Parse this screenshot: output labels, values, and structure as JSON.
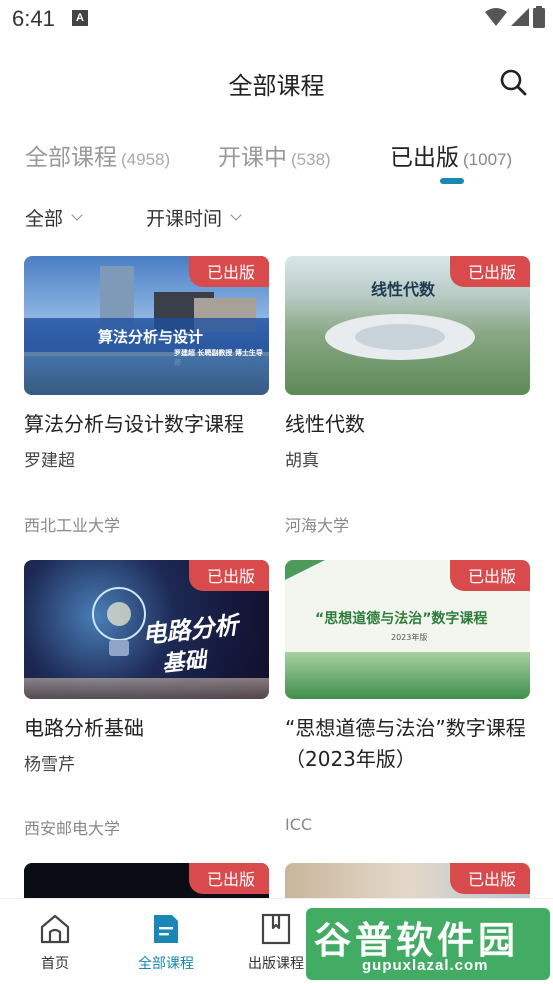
{
  "status_bar": {
    "time": "6:41",
    "notif_letter": "A"
  },
  "header": {
    "title": "全部课程"
  },
  "tabs": [
    {
      "label": "全部课程",
      "count": "(4958)"
    },
    {
      "label": "开课中",
      "count": "(538)"
    },
    {
      "label": "已出版",
      "count": "(1007)"
    }
  ],
  "active_tab": "已出版",
  "filters": {
    "category": "全部",
    "sort": "开课时间"
  },
  "badge_label": "已出版",
  "courses": [
    {
      "title": "算法分析与设计数字课程",
      "teacher": "罗建超",
      "school": "西北工业大学",
      "cover_text": "算法分析与设计",
      "cover_subtext": "罗建超 长聘副教授 博士生导师"
    },
    {
      "title": "线性代数",
      "teacher": "胡真",
      "school": "河海大学",
      "cover_text": "线性代数"
    },
    {
      "title": "电路分析基础",
      "teacher": "杨雪芹",
      "school": "西安邮电大学",
      "cover_text_1": "电路分析",
      "cover_text_2": "基础"
    },
    {
      "title": "“思想道德与法治”数字课程（2023年版）",
      "teacher": "",
      "school": "ICC",
      "cover_text": "“思想道德与法治”数字课程",
      "cover_subtext": "2023年版"
    },
    {
      "title": "",
      "teacher": "",
      "school": ""
    },
    {
      "title": "",
      "teacher": "",
      "school": ""
    }
  ],
  "bottom_nav": [
    {
      "label": "首页",
      "icon": "home-icon"
    },
    {
      "label": "全部课程",
      "icon": "courses-icon"
    },
    {
      "label": "出版课程",
      "icon": "bookmark-book-icon"
    },
    {
      "label": "",
      "icon": ""
    },
    {
      "label": "",
      "icon": ""
    }
  ],
  "watermark": {
    "main": "谷普软件园",
    "sub": "gupuxlazal.com"
  },
  "colors": {
    "accent": "#1a87b5",
    "badge": "#d94a4d"
  }
}
